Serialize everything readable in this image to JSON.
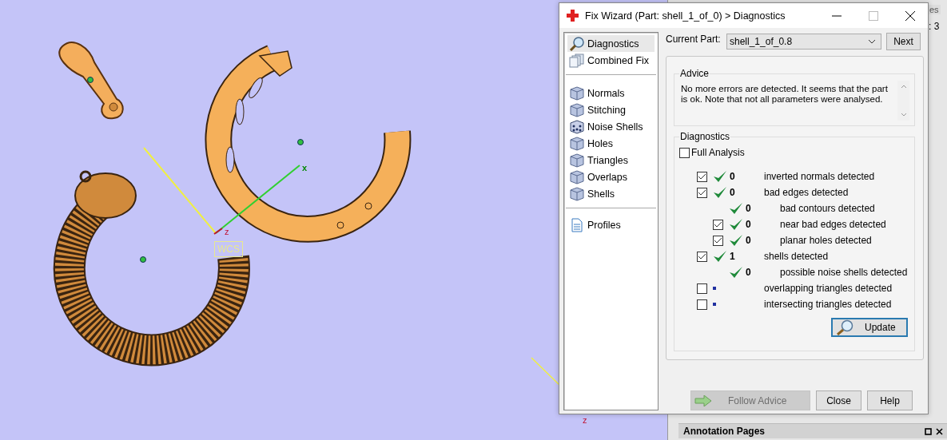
{
  "viewport": {
    "axis_labels": [
      "x",
      "z"
    ],
    "wcs_label": "WCS",
    "corner_axis_label": "z"
  },
  "side_panel": {
    "tab_text": "es",
    "count_text": ": 3",
    "annotation_title": "Annotation Pages"
  },
  "dialog": {
    "title": "Fix Wizard (Part: shell_1_of_0) > Diagnostics",
    "sidebar": [
      [
        {
          "label": "Diagnostics",
          "kind": "search",
          "selected": true
        },
        {
          "label": "Combined Fix",
          "kind": "stack",
          "selected": false
        }
      ],
      [
        {
          "label": "Normals",
          "kind": "cube",
          "selected": false
        },
        {
          "label": "Stitching",
          "kind": "cube",
          "selected": false
        },
        {
          "label": "Noise Shells",
          "kind": "dice",
          "selected": false
        },
        {
          "label": "Holes",
          "kind": "cube",
          "selected": false
        },
        {
          "label": "Triangles",
          "kind": "cube",
          "selected": false
        },
        {
          "label": "Overlaps",
          "kind": "cube",
          "selected": false
        },
        {
          "label": "Shells",
          "kind": "cube",
          "selected": false
        }
      ],
      [
        {
          "label": "Profiles",
          "kind": "document",
          "selected": false
        }
      ]
    ],
    "current_part_label": "Current Part:",
    "current_part": "shell_1_of_0.8",
    "next_button": "Next",
    "advice": {
      "title": "Advice",
      "text": "No more errors are detected. It seems that the part is ok. Note that not all parameters were analysed."
    },
    "diagnostics": {
      "title": "Diagnostics",
      "full_analysis": {
        "label": "Full Analysis",
        "checked": false
      },
      "checks": [
        {
          "kind": "checkbox",
          "checked": true,
          "passed": true,
          "count": "0",
          "label": "inverted normals detected"
        },
        {
          "kind": "checkbox",
          "checked": true,
          "passed": true,
          "count": "0",
          "label": "bad edges detected",
          "children": [
            {
              "kind": "plain",
              "passed": true,
              "count": "0",
              "label": "bad contours detected"
            },
            {
              "kind": "checkbox",
              "checked": true,
              "passed": true,
              "count": "0",
              "label": "near bad edges detected"
            },
            {
              "kind": "checkbox",
              "checked": true,
              "passed": true,
              "count": "0",
              "label": "planar holes detected"
            }
          ]
        },
        {
          "kind": "checkbox",
          "checked": true,
          "passed": true,
          "count": "1",
          "label": "shells detected",
          "children": [
            {
              "kind": "plain",
              "passed": true,
              "count": "0",
              "label": "possible noise shells detected"
            }
          ]
        },
        {
          "kind": "checkbox",
          "checked": false,
          "passed": false,
          "label": "overlapping triangles detected"
        },
        {
          "kind": "checkbox",
          "checked": false,
          "passed": false,
          "label": "intersecting triangles detected"
        }
      ],
      "update_button": "Update"
    },
    "footer_buttons": [
      {
        "label": "Follow Advice",
        "kind": "advice",
        "disabled": true
      },
      {
        "label": "Close",
        "kind": "plain",
        "disabled": false
      },
      {
        "label": "Help",
        "kind": "plain",
        "disabled": false
      }
    ]
  }
}
